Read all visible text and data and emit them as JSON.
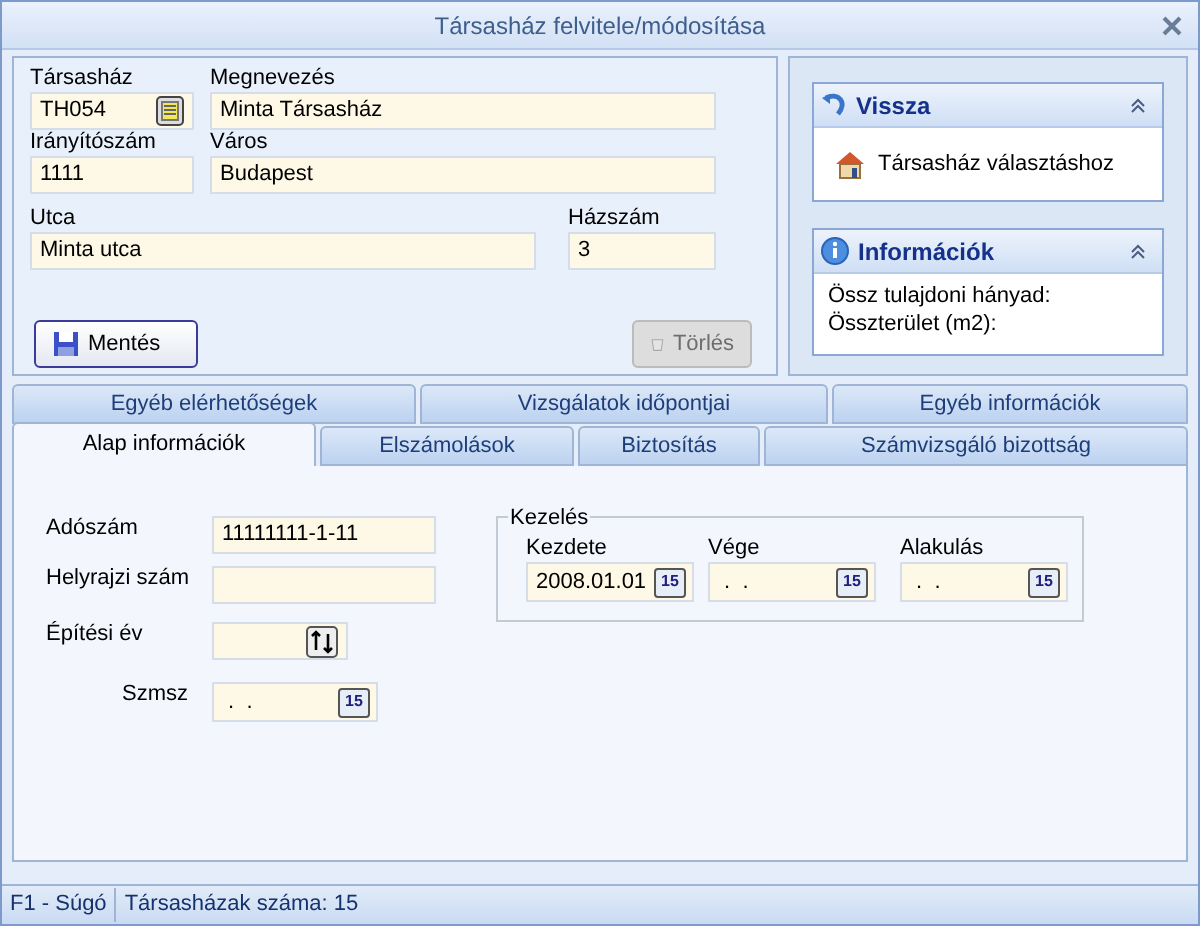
{
  "window": {
    "title": "Társasház felvitele/módosítása"
  },
  "header": {
    "fields": [
      {
        "label": "Társasház",
        "value": "TH054",
        "kind": "lookup"
      },
      {
        "label": "Megnevezés",
        "value": "Minta Társasház",
        "kind": "text"
      },
      {
        "label": "Irányítószám",
        "value": "1111",
        "kind": "text"
      },
      {
        "label": "Város",
        "value": "Budapest",
        "kind": "text"
      },
      {
        "label": "Utca",
        "value": "Minta utca",
        "kind": "text"
      },
      {
        "label": "Házszám",
        "value": "3",
        "kind": "text"
      }
    ],
    "buttons": [
      {
        "label": "Mentés",
        "disabled": false
      },
      {
        "label": "Törlés",
        "disabled": true
      }
    ]
  },
  "side_panels": [
    {
      "title": "Vissza",
      "kind": "link",
      "items": [
        "Társasház választáshoz"
      ]
    },
    {
      "title": "Információk",
      "kind": "info",
      "items": [
        "Össz tulajdoni hányad:",
        "Összterület (m2):"
      ]
    }
  ],
  "tabs": [
    [
      {
        "label": "Egyéb elérhetőségek",
        "selected": false
      },
      {
        "label": "Vizsgálatok időpontjai",
        "selected": false
      },
      {
        "label": "Egyéb információk",
        "selected": false
      }
    ],
    [
      {
        "label": "Alap információk",
        "selected": true
      },
      {
        "label": "Elszámolások",
        "selected": false
      },
      {
        "label": "Biztosítás",
        "selected": false
      },
      {
        "label": "Számvizsgáló bizottság",
        "selected": false
      }
    ]
  ],
  "form": {
    "fields": [
      {
        "label": "Adószám",
        "value": "11111111-1-11",
        "kind": "text"
      },
      {
        "label": "Helyrajzi szám",
        "kind": "text"
      },
      {
        "label": "Építési év",
        "kind": "spin"
      },
      {
        "label": "Szmsz",
        "value": " .  .",
        "kind": "date",
        "calendar": "15"
      }
    ],
    "group": {
      "title": "Kezelés",
      "fields": [
        {
          "label": "Kezdete",
          "value": "2008.01.01",
          "calendar": "15"
        },
        {
          "label": "Vége",
          "value": " .  .",
          "calendar": "15"
        },
        {
          "label": "Alakulás",
          "value": " .  .",
          "calendar": "15"
        }
      ]
    }
  },
  "status_bar": [
    "F1 - Súgó",
    "Társasházak száma: 15"
  ]
}
